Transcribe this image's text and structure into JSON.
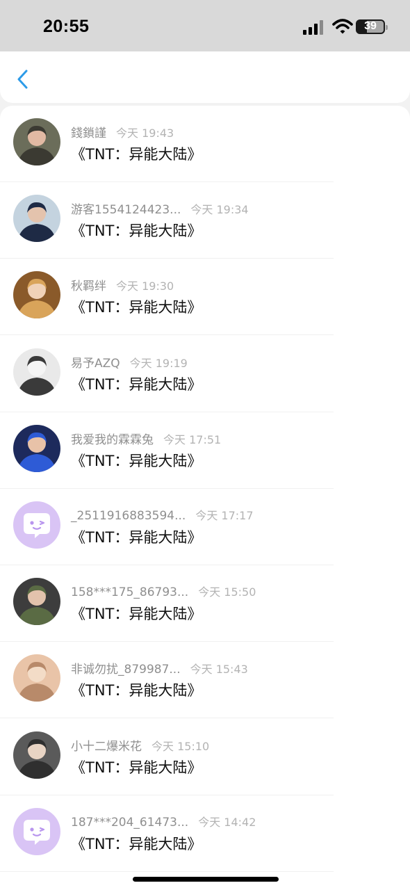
{
  "status": {
    "time": "20:55",
    "battery": "39"
  },
  "nav": {
    "back_icon": "chevron-left-icon"
  },
  "items": [
    {
      "name": "錢鎖謹",
      "time": "今天 19:43",
      "message": "《TNT：异能大陆》",
      "avatar": "photo"
    },
    {
      "name": "游客1554124423...",
      "time": "今天 19:34",
      "message": "《TNT：异能大陆》",
      "avatar": "photo"
    },
    {
      "name": "秋羁绊",
      "time": "今天 19:30",
      "message": "《TNT：异能大陆》",
      "avatar": "photo"
    },
    {
      "name": "易予AZQ",
      "time": "今天 19:19",
      "message": "《TNT：异能大陆》",
      "avatar": "photo"
    },
    {
      "name": "我爱我的霖霖兔",
      "time": "今天 17:51",
      "message": "《TNT：异能大陆》",
      "avatar": "photo"
    },
    {
      "name": "_2511916883594...",
      "time": "今天 17:17",
      "message": "《TNT：异能大陆》",
      "avatar": "default-chat-bubble"
    },
    {
      "name": "158***175_86793...",
      "time": "今天 15:50",
      "message": "《TNT：异能大陆》",
      "avatar": "photo"
    },
    {
      "name": "非诚勿扰_879987...",
      "time": "今天 15:43",
      "message": "《TNT：异能大陆》",
      "avatar": "photo"
    },
    {
      "name": "小十二爆米花",
      "time": "今天 15:10",
      "message": "《TNT：异能大陆》",
      "avatar": "photo"
    },
    {
      "name": "187***204_61473...",
      "time": "今天 14:42",
      "message": "《TNT：异能大陆》",
      "avatar": "default-chat-bubble"
    }
  ],
  "colors": {
    "accent": "#2d9be8",
    "default_avatar_bg": "#d9c4f5"
  }
}
